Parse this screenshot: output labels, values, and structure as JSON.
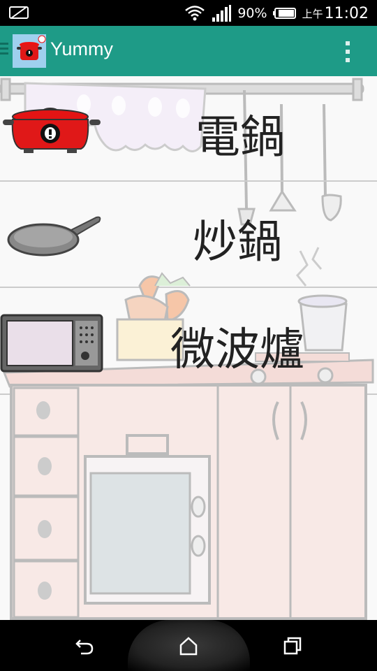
{
  "status_bar": {
    "battery_percent": "90%",
    "ampm": "上午",
    "time": "11:02",
    "icons": [
      "no-sim-icon",
      "wifi-icon",
      "signal-icon",
      "battery-icon"
    ]
  },
  "app_bar": {
    "title": "Yummy",
    "color": "#1e9b87"
  },
  "appliances": [
    {
      "label": "電鍋",
      "icon": "rice-cooker-icon"
    },
    {
      "label": "炒鍋",
      "icon": "frying-pan-icon"
    },
    {
      "label": "微波爐",
      "icon": "microwave-icon"
    }
  ],
  "nav_bar": {
    "buttons": [
      "back-icon",
      "home-icon",
      "recent-apps-icon"
    ]
  }
}
